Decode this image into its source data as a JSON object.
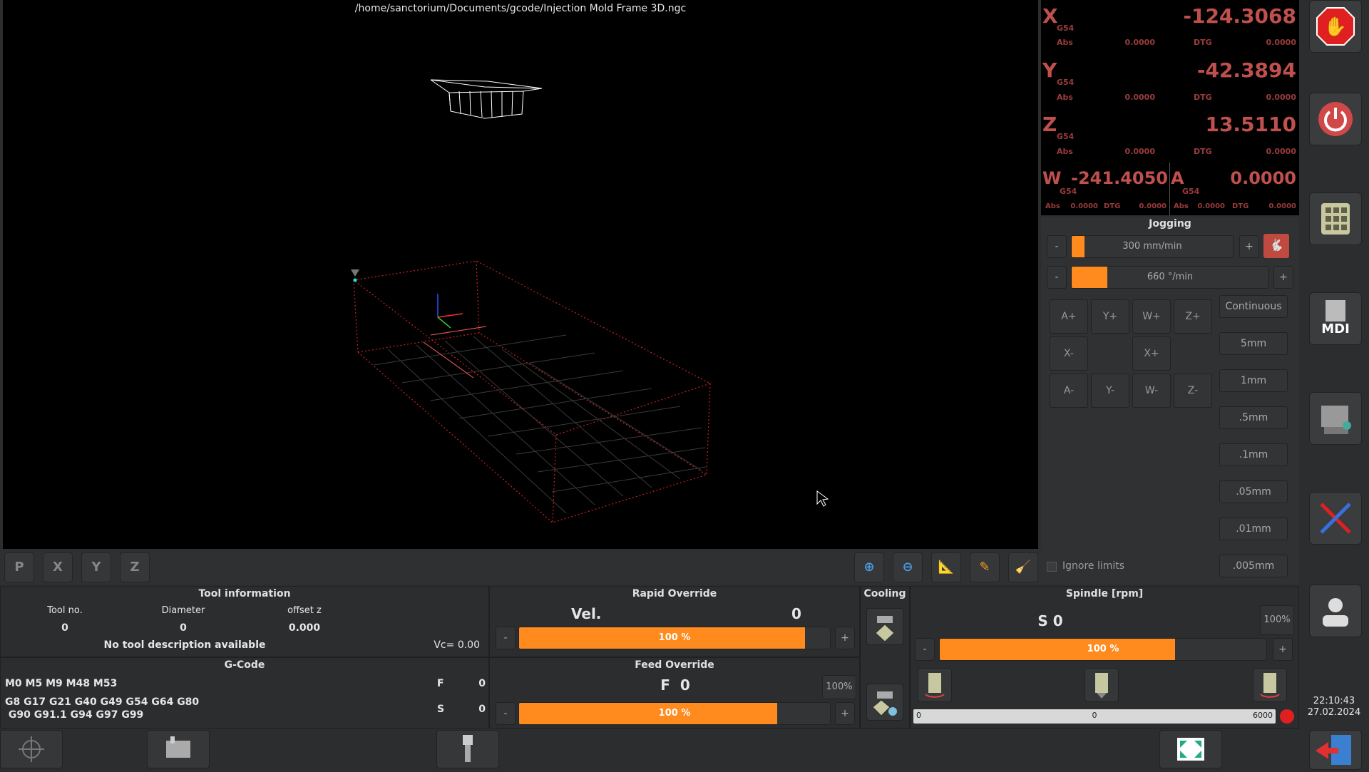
{
  "file_path": "/home/sanctorium/Documents/gcode/Injection Mold Frame 3D.ngc",
  "dro": {
    "x": {
      "label": "X",
      "wcs": "G54",
      "value": "-124.3068",
      "abs_label": "Abs",
      "abs": "0.0000",
      "dtg_label": "DTG",
      "dtg": "0.0000"
    },
    "y": {
      "label": "Y",
      "wcs": "G54",
      "value": "-42.3894",
      "abs_label": "Abs",
      "abs": "0.0000",
      "dtg_label": "DTG",
      "dtg": "0.0000"
    },
    "z": {
      "label": "Z",
      "wcs": "G54",
      "value": "13.5110",
      "abs_label": "Abs",
      "abs": "0.0000",
      "dtg_label": "DTG",
      "dtg": "0.0000"
    },
    "w": {
      "label": "W",
      "wcs": "G54",
      "value": "-241.4050",
      "abs_label": "Abs",
      "abs": "0.0000",
      "dtg_label": "DTG",
      "dtg": "0.0000"
    },
    "a": {
      "label": "A",
      "wcs": "G54",
      "value": "0.0000",
      "abs_label": "Abs",
      "abs": "0.0000",
      "dtg_label": "DTG",
      "dtg": "0.0000"
    }
  },
  "jogging": {
    "title": "Jogging",
    "linear_speed": "300 mm/min",
    "linear_fraction": 0.08,
    "angular_speed": "660 °/min",
    "angular_fraction": 0.18,
    "minus": "-",
    "plus": "+",
    "buttons": [
      "A+",
      "Y+",
      "W+",
      "Z+",
      "X-",
      "X+",
      "A-",
      "Y-",
      "W-",
      "Z-"
    ],
    "steps": [
      "Continuous",
      "5mm",
      "1mm",
      ".5mm",
      ".1mm",
      ".05mm",
      ".01mm",
      ".005mm"
    ],
    "ignore_limits": "Ignore limits"
  },
  "tool_info": {
    "title": "Tool information",
    "tool_no_label": "Tool no.",
    "diameter_label": "Diameter",
    "offset_label": "offset z",
    "tool_no": "0",
    "diameter": "0",
    "offset": "0.000",
    "description": "No tool description available",
    "vc": "Vc= 0.00"
  },
  "gcode": {
    "title": "G-Code",
    "mcodes": "M0 M5 M9 M48 M53",
    "gcodes_line1": "G8 G17 G21 G40 G49 G54 G64 G80",
    "gcodes_line2": " G90 G91.1 G94 G97 G99",
    "f_label": "F",
    "f_value": "0",
    "s_label": "S",
    "s_value": "0"
  },
  "rapid": {
    "title": "Rapid Override",
    "vel_label": "Vel.",
    "vel_value": "0",
    "percent": "100 %",
    "fraction": 0.92
  },
  "feed": {
    "title": "Feed Override",
    "f_text": "F  0",
    "percent": "100 %",
    "fraction": 0.83,
    "max_btn": "100%"
  },
  "cooling": {
    "title": "Cooling"
  },
  "spindle": {
    "title": "Spindle [rpm]",
    "s_text": "S 0",
    "percent": "100 %",
    "fraction": 0.72,
    "max_btn": "100%",
    "bar_min": "0",
    "bar_mid": "0",
    "bar_max": "6000"
  },
  "clock": {
    "time": "22:10:43",
    "date": "27.02.2024"
  },
  "colors": {
    "accent": "#ff8a1e",
    "dro_red": "#c0504d",
    "stop_red": "#e02020"
  }
}
